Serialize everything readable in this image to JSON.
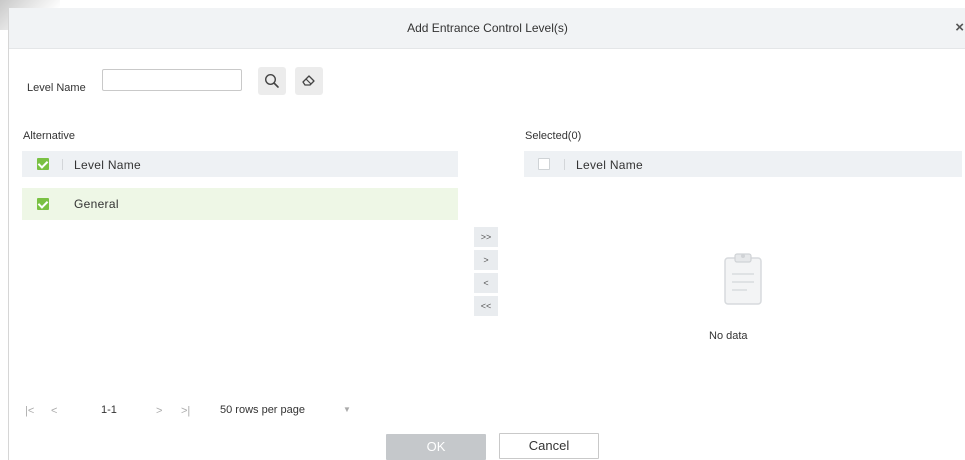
{
  "dialog": {
    "title": "Add Entrance Control Level(s)",
    "close_label": "×"
  },
  "search": {
    "label": "Level Name",
    "value": "",
    "placeholder": ""
  },
  "left_panel": {
    "label": "Alternative",
    "column_header": "Level Name",
    "rows": [
      {
        "name": "General",
        "checked": true
      }
    ]
  },
  "right_panel": {
    "label": "Selected(0)",
    "column_header": "Level Name",
    "empty_text": "No data"
  },
  "transfer_buttons": {
    "move_all_right": ">>",
    "move_right": ">",
    "move_left": "<",
    "move_all_left": "<<"
  },
  "pagination": {
    "first": "|<",
    "prev": "<",
    "range": "1-1",
    "next": ">",
    "last": ">|",
    "rows_per_page": "50 rows per page",
    "dropdown": "▼"
  },
  "footer": {
    "ok_label": "OK",
    "cancel_label": "Cancel"
  },
  "colors": {
    "check_green": "#7ac143",
    "selected_row": "#eef7e6",
    "header_bg": "#eef1f4",
    "ok_disabled": "#c5c8cb"
  },
  "icons": [
    "search-icon",
    "eraser-icon",
    "close-icon",
    "clipboard-icon",
    "dropdown-arrow-icon"
  ]
}
